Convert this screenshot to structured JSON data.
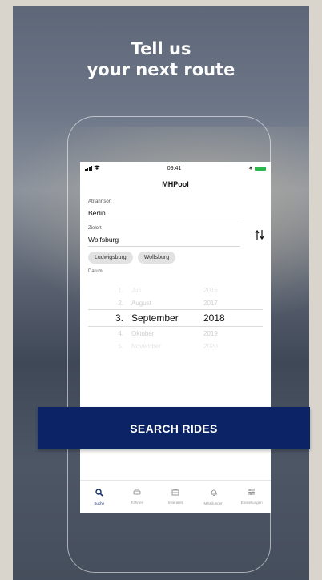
{
  "headline": {
    "line1": "Tell us",
    "line2": "your next route"
  },
  "statusbar": {
    "time": "09:41",
    "wifi_icon": "wifi-icon",
    "bluetooth": "∗"
  },
  "app": {
    "title": "MHPool"
  },
  "form": {
    "departure_label": "Abfahrtsort",
    "departure_value": "Berlin",
    "destination_label": "Zielort",
    "destination_value": "Wolfsburg",
    "swap_icon": "swap-vertical-icon",
    "suggestions": [
      "Ludwigsburg",
      "Wolfsburg"
    ],
    "date_label": "Datum"
  },
  "date_picker": {
    "rows": [
      {
        "day": "1.",
        "month": "Juli",
        "year": "2016",
        "style": "ghost"
      },
      {
        "day": "2.",
        "month": "August",
        "year": "2017",
        "style": "faded"
      },
      {
        "day": "3.",
        "month": "September",
        "year": "2018",
        "style": "selected"
      },
      {
        "day": "4.",
        "month": "Oktober",
        "year": "2019",
        "style": "faded"
      },
      {
        "day": "5.",
        "month": "November",
        "year": "2020",
        "style": "ghost"
      }
    ]
  },
  "search_button": {
    "label": "SEARCH RIDES"
  },
  "tabbar": {
    "items": [
      {
        "label": "Suche",
        "icon": "search-icon",
        "active": true
      },
      {
        "label": "Fahrten",
        "icon": "car-icon",
        "active": false
      },
      {
        "label": "Inserates",
        "icon": "listing-icon",
        "active": false
      },
      {
        "label": "Mitteilungen",
        "icon": "bell-icon",
        "active": false
      },
      {
        "label": "Einstellungen",
        "icon": "sliders-icon",
        "active": false
      }
    ]
  },
  "colors": {
    "accent": "#0c2466",
    "battery": "#2db84d"
  }
}
